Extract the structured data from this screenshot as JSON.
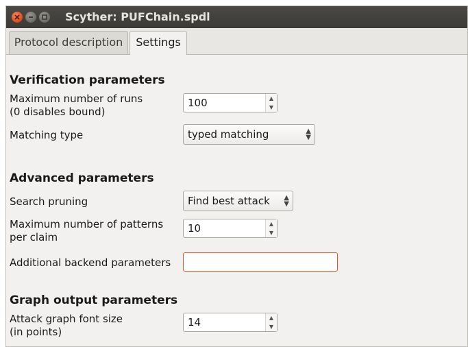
{
  "window": {
    "title": "Scyther: PUFChain.spdl"
  },
  "tabs": [
    {
      "label": "Protocol description",
      "active": false
    },
    {
      "label": "Settings",
      "active": true
    }
  ],
  "verification": {
    "title": "Verification parameters",
    "max_runs_label_1": "Maximum number of runs",
    "max_runs_label_2": "(0 disables bound)",
    "max_runs_value": "100",
    "matching_label": "Matching type",
    "matching_value": "typed matching"
  },
  "advanced": {
    "title": "Advanced parameters",
    "pruning_label": "Search pruning",
    "pruning_value": "Find best attack",
    "max_patterns_label_1": "Maximum number of patterns",
    "max_patterns_label_2": "per claim",
    "max_patterns_value": "10",
    "backend_label": "Additional backend parameters",
    "backend_value": ""
  },
  "graph": {
    "title": "Graph output parameters",
    "font_size_label_1": "Attack graph font size",
    "font_size_label_2": "(in points)",
    "font_size_value": "14"
  },
  "colors": {
    "titlebar": "#3c3b37",
    "close_button": "#dd4814",
    "focus_border": "#e05a2a",
    "window_bg": "#f2f1f0"
  },
  "icons": {
    "close": "close-icon",
    "minimize": "minimize-icon",
    "maximize": "maximize-icon",
    "spin_up": "chevron-up-icon",
    "spin_down": "chevron-down-icon",
    "combo": "updown-caret-icon"
  }
}
